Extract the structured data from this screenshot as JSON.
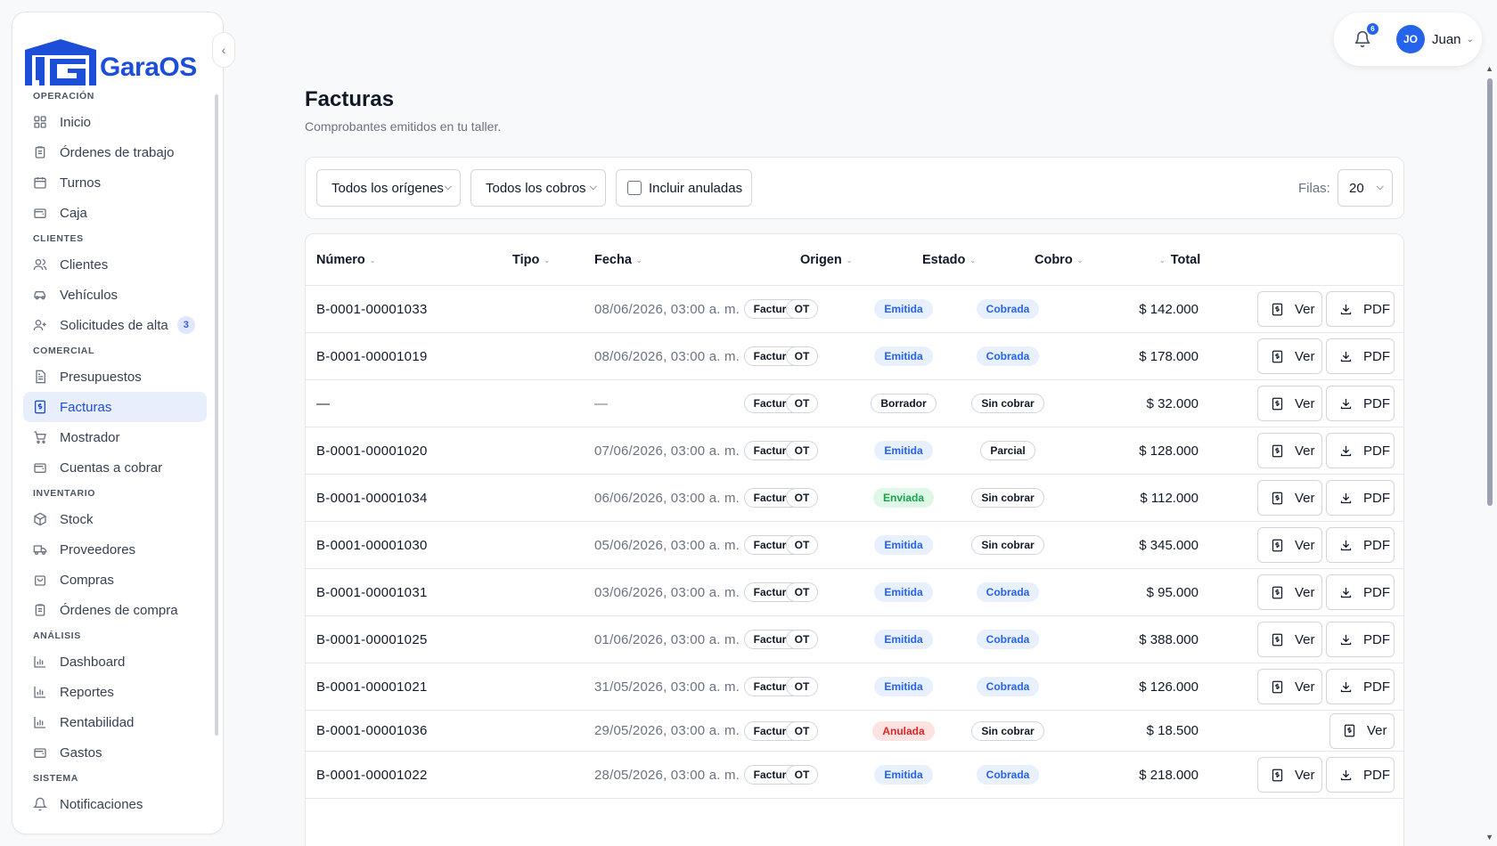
{
  "brand": {
    "name": "GaraOS"
  },
  "sidebar": {
    "sections": [
      {
        "label": "OPERACIÓN",
        "items": [
          {
            "label": "Inicio",
            "icon": "grid-icon"
          },
          {
            "label": "Órdenes de trabajo",
            "icon": "clipboard-icon"
          },
          {
            "label": "Turnos",
            "icon": "calendar-icon"
          },
          {
            "label": "Caja",
            "icon": "wallet-icon"
          }
        ]
      },
      {
        "label": "CLIENTES",
        "items": [
          {
            "label": "Clientes",
            "icon": "users-icon"
          },
          {
            "label": "Vehículos",
            "icon": "car-icon"
          },
          {
            "label": "Solicitudes de alta",
            "icon": "user-plus-icon",
            "badge": "3"
          }
        ]
      },
      {
        "label": "COMERCIAL",
        "items": [
          {
            "label": "Presupuestos",
            "icon": "file-text-icon"
          },
          {
            "label": "Facturas",
            "icon": "invoice-icon",
            "active": true
          },
          {
            "label": "Mostrador",
            "icon": "cart-icon"
          },
          {
            "label": "Cuentas a cobrar",
            "icon": "wallet-icon"
          }
        ]
      },
      {
        "label": "INVENTARIO",
        "items": [
          {
            "label": "Stock",
            "icon": "box-icon"
          },
          {
            "label": "Proveedores",
            "icon": "truck-icon"
          },
          {
            "label": "Compras",
            "icon": "shopping-bag-icon"
          },
          {
            "label": "Órdenes de compra",
            "icon": "clipboard-icon"
          }
        ]
      },
      {
        "label": "ANÁLISIS",
        "items": [
          {
            "label": "Dashboard",
            "icon": "bar-chart-icon"
          },
          {
            "label": "Reportes",
            "icon": "bar-chart-icon"
          },
          {
            "label": "Rentabilidad",
            "icon": "bar-chart-icon"
          },
          {
            "label": "Gastos",
            "icon": "wallet-icon"
          }
        ]
      },
      {
        "label": "SISTEMA",
        "items": [
          {
            "label": "Notificaciones",
            "icon": "bell-icon"
          }
        ]
      }
    ]
  },
  "topbar": {
    "notification_count": "6",
    "avatar_initials": "JO",
    "user_name": "Juan"
  },
  "page": {
    "title": "Facturas",
    "subtitle": "Comprobantes emitidos en tu taller."
  },
  "filters": {
    "origin_select": "Todos los orígenes",
    "payment_select": "Todos los cobros",
    "include_voided_label": "Incluir anuladas",
    "include_voided_checked": false,
    "rows_label": "Filas:",
    "rows_value": "20"
  },
  "table": {
    "columns": [
      "Número",
      "Tipo",
      "Fecha",
      "Origen",
      "Estado",
      "Cobro",
      "Total"
    ],
    "rows": [
      {
        "numero": "B-0001-00001033",
        "tipo": "Factura B",
        "fecha": "08/06/2026, 03:00 a. m.",
        "origen": "OT",
        "estado": "Emitida",
        "estado_style": "blue",
        "cobro": "Cobrada",
        "cobro_style": "blue",
        "total": "$ 142.000",
        "pdf": true
      },
      {
        "numero": "B-0001-00001019",
        "tipo": "Factura B",
        "fecha": "08/06/2026, 03:00 a. m.",
        "origen": "OT",
        "estado": "Emitida",
        "estado_style": "blue",
        "cobro": "Cobrada",
        "cobro_style": "blue",
        "total": "$ 178.000",
        "pdf": true
      },
      {
        "numero": "—",
        "tipo": "Factura B",
        "fecha": "—",
        "origen": "OT",
        "estado": "Borrador",
        "estado_style": "outline",
        "cobro": "Sin cobrar",
        "cobro_style": "outline",
        "total": "$ 32.000",
        "pdf": true
      },
      {
        "numero": "B-0001-00001020",
        "tipo": "Factura B",
        "fecha": "07/06/2026, 03:00 a. m.",
        "origen": "OT",
        "estado": "Emitida",
        "estado_style": "blue",
        "cobro": "Parcial",
        "cobro_style": "gray",
        "total": "$ 128.000",
        "pdf": true
      },
      {
        "numero": "B-0001-00001034",
        "tipo": "Factura B",
        "fecha": "06/06/2026, 03:00 a. m.",
        "origen": "OT",
        "estado": "Enviada",
        "estado_style": "green",
        "cobro": "Sin cobrar",
        "cobro_style": "outline",
        "total": "$ 112.000",
        "pdf": true
      },
      {
        "numero": "B-0001-00001030",
        "tipo": "Factura B",
        "fecha": "05/06/2026, 03:00 a. m.",
        "origen": "OT",
        "estado": "Emitida",
        "estado_style": "blue",
        "cobro": "Sin cobrar",
        "cobro_style": "outline",
        "total": "$ 345.000",
        "pdf": true
      },
      {
        "numero": "B-0001-00001031",
        "tipo": "Factura B",
        "fecha": "03/06/2026, 03:00 a. m.",
        "origen": "OT",
        "estado": "Emitida",
        "estado_style": "blue",
        "cobro": "Cobrada",
        "cobro_style": "blue",
        "total": "$ 95.000",
        "pdf": true
      },
      {
        "numero": "B-0001-00001025",
        "tipo": "Factura B",
        "fecha": "01/06/2026, 03:00 a. m.",
        "origen": "OT",
        "estado": "Emitida",
        "estado_style": "blue",
        "cobro": "Cobrada",
        "cobro_style": "blue",
        "total": "$ 388.000",
        "pdf": true
      },
      {
        "numero": "B-0001-00001021",
        "tipo": "Factura B",
        "fecha": "31/05/2026, 03:00 a. m.",
        "origen": "OT",
        "estado": "Emitida",
        "estado_style": "blue",
        "cobro": "Cobrada",
        "cobro_style": "blue",
        "total": "$ 126.000",
        "pdf": true
      },
      {
        "numero": "B-0001-00001036",
        "tipo": "Factura B",
        "fecha": "29/05/2026, 03:00 a. m.",
        "origen": "OT",
        "estado": "Anulada",
        "estado_style": "red",
        "cobro": "Sin cobrar",
        "cobro_style": "outline",
        "total": "$ 18.500",
        "pdf": false
      },
      {
        "numero": "B-0001-00001022",
        "tipo": "Factura B",
        "fecha": "28/05/2026, 03:00 a. m.",
        "origen": "OT",
        "estado": "Emitida",
        "estado_style": "blue",
        "cobro": "Cobrada",
        "cobro_style": "blue",
        "total": "$ 218.000",
        "pdf": true
      }
    ],
    "view_label": "Ver",
    "pdf_label": "PDF"
  },
  "colors": {
    "accent": "#2563eb",
    "active_bg": "#e8eefc"
  }
}
